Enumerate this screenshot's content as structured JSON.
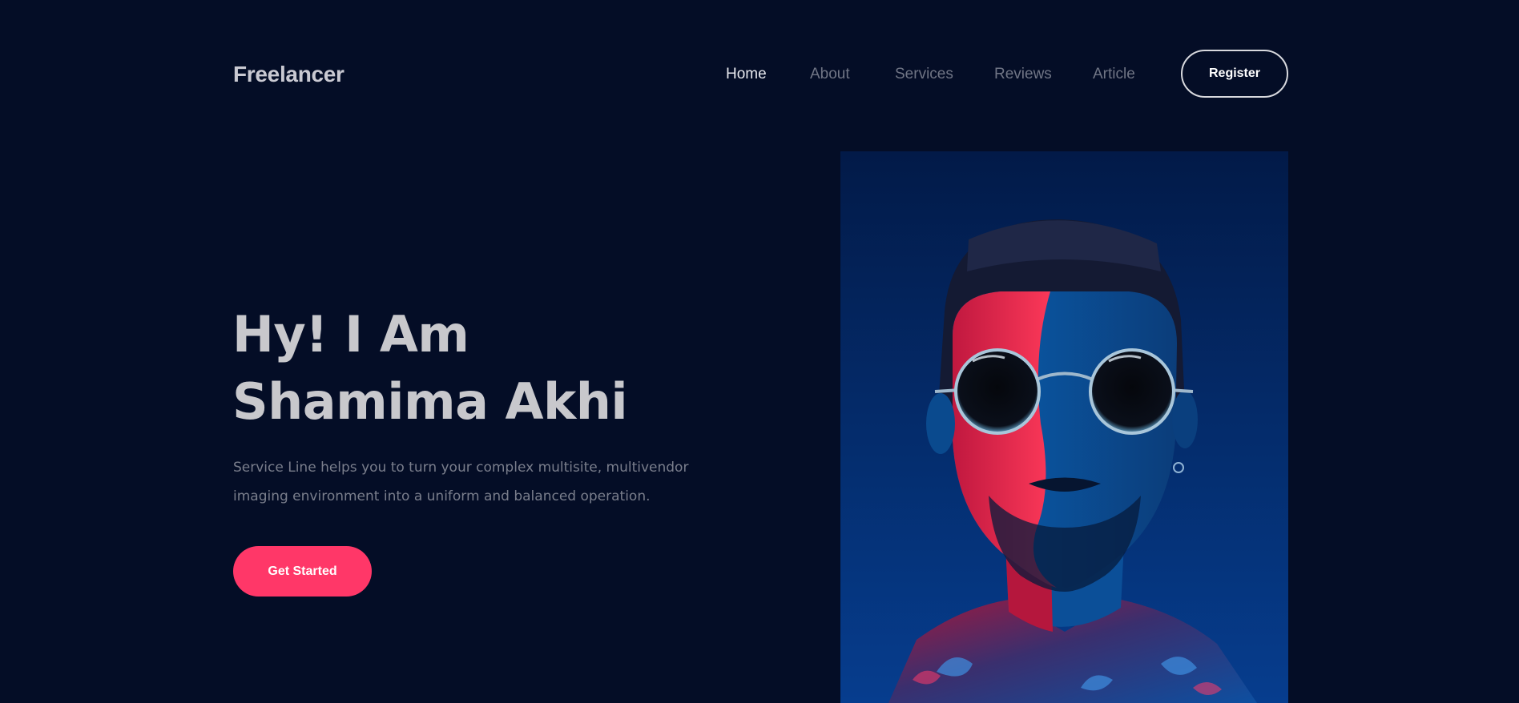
{
  "header": {
    "logo": "Freelancer",
    "nav": [
      {
        "label": "Home",
        "active": true
      },
      {
        "label": "About",
        "active": false
      },
      {
        "label": "Services",
        "active": false
      },
      {
        "label": "Reviews",
        "active": false
      },
      {
        "label": "Article",
        "active": false
      }
    ],
    "register_label": "Register"
  },
  "hero": {
    "title_line1": "Hy! I Am",
    "title_line2": "Shamima Akhi",
    "description_line1": "Service Line helps you to turn your complex multisite, multivendor",
    "description_line2": "imaging environment into a uniform and balanced operation.",
    "cta_label": "Get Started"
  },
  "colors": {
    "background": "#040d26",
    "accent": "#ff3768",
    "portrait_blue": "#04306f",
    "portrait_red": "#ff2350"
  },
  "portrait": {
    "icon": "person-portrait-photo"
  }
}
